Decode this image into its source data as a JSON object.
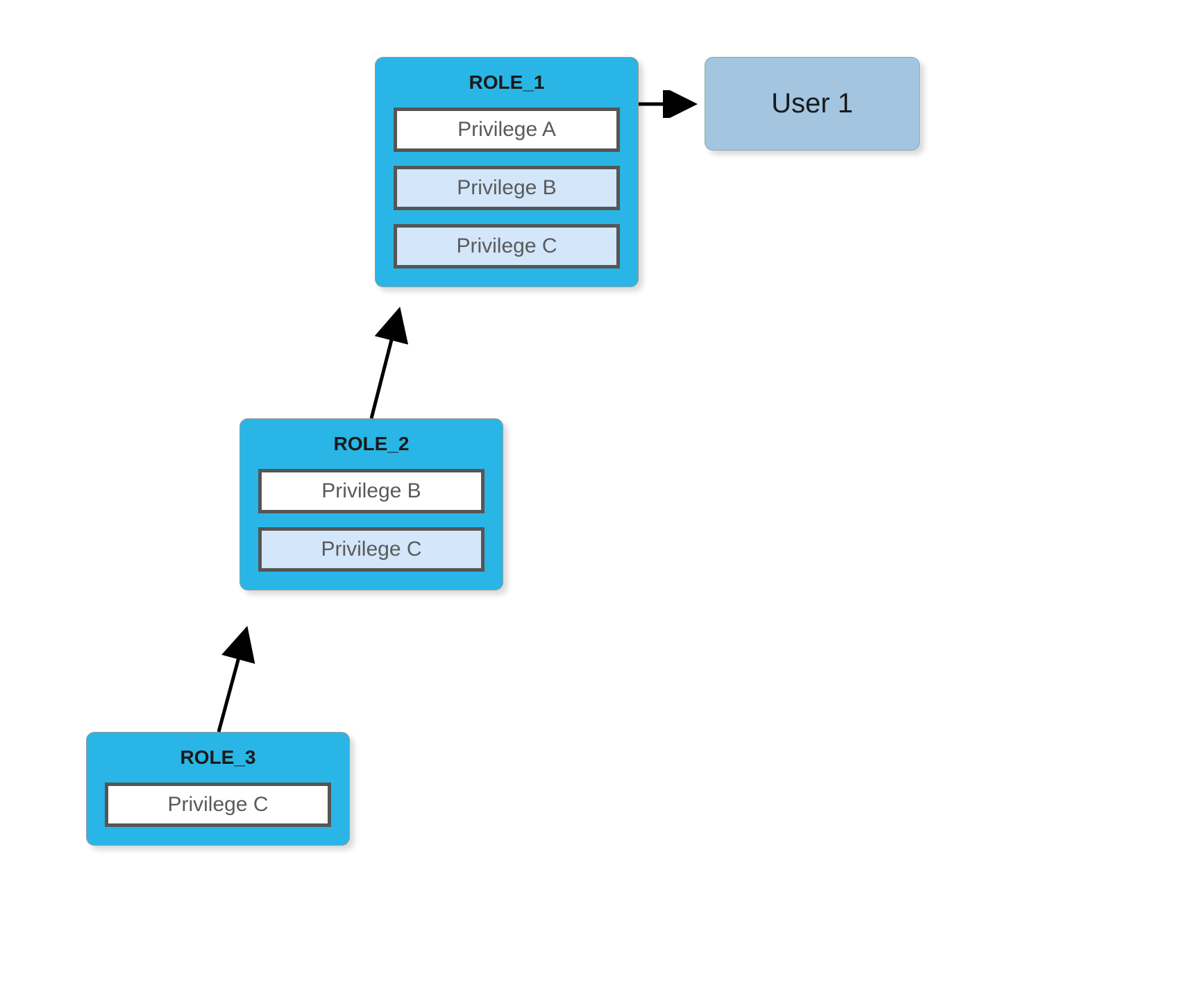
{
  "diagram": {
    "user": {
      "label": "User 1"
    },
    "roles": [
      {
        "id": "role1",
        "title": "ROLE_1",
        "privileges": [
          {
            "label": "Privilege A",
            "inherited": false
          },
          {
            "label": "Privilege B",
            "inherited": true
          },
          {
            "label": "Privilege C",
            "inherited": true
          }
        ]
      },
      {
        "id": "role2",
        "title": "ROLE_2",
        "privileges": [
          {
            "label": "Privilege B",
            "inherited": false
          },
          {
            "label": "Privilege C",
            "inherited": true
          }
        ]
      },
      {
        "id": "role3",
        "title": "ROLE_3",
        "privileges": [
          {
            "label": "Privilege C",
            "inherited": false
          }
        ]
      }
    ],
    "edges": [
      {
        "from": "role3",
        "to": "role2"
      },
      {
        "from": "role2",
        "to": "role1"
      },
      {
        "from": "role1",
        "to": "user"
      }
    ]
  }
}
